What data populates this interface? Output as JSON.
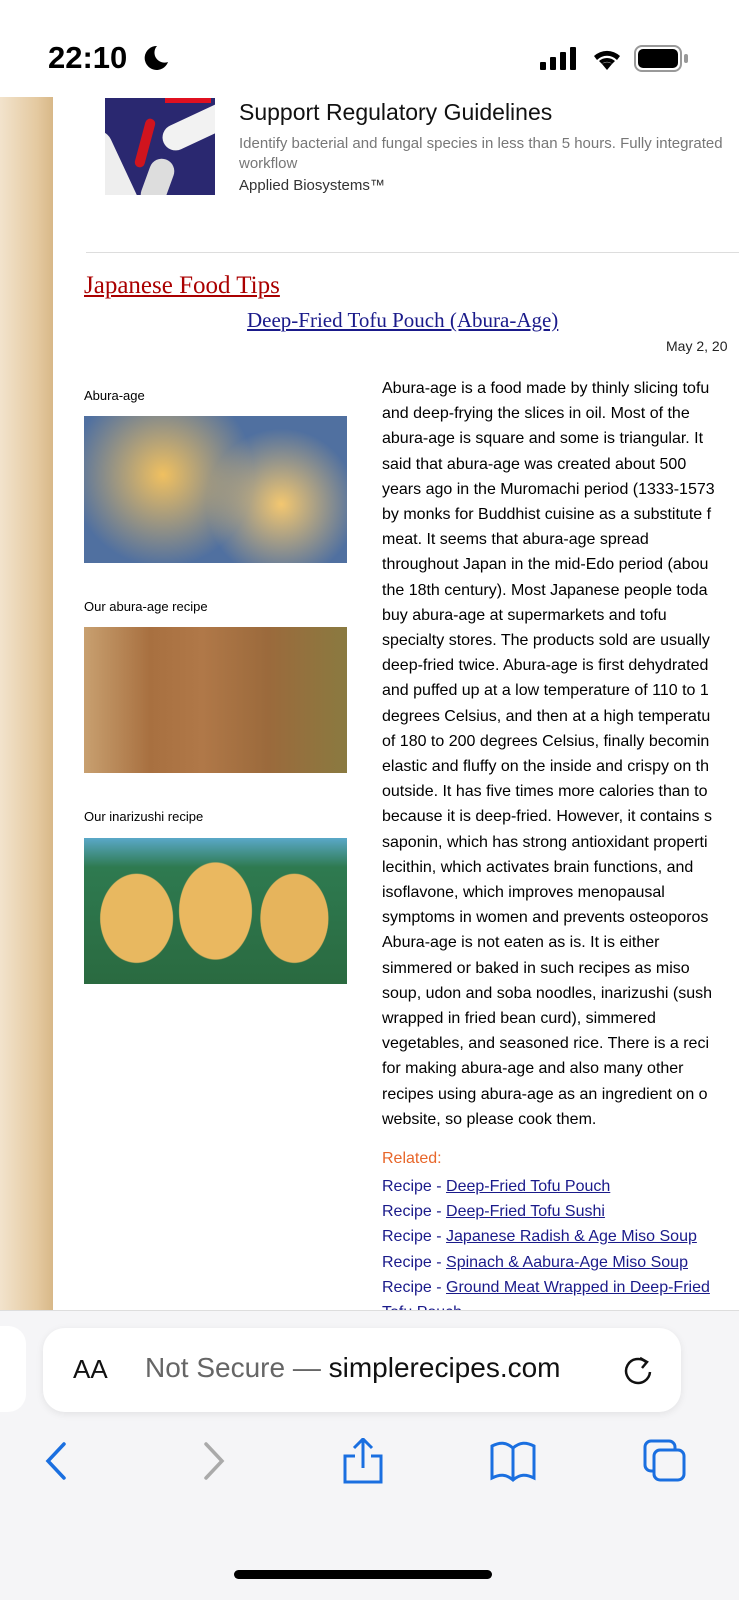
{
  "status_bar": {
    "time": "22:10"
  },
  "ad": {
    "title": "Support Regulatory Guidelines",
    "description": "Identify bacterial and fungal species in less than 5 hours. Fully integrated workflow",
    "brand": "Applied Biosystems™"
  },
  "page": {
    "site_title": "Japanese Food Tips",
    "article_title": "Deep-Fried Tofu Pouch (Abura-Age)",
    "date": "May 2, 20",
    "captions": [
      "Abura-age",
      "Our abura-age recipe",
      "Our inarizushi recipe"
    ],
    "body_lines": [
      "Abura-age is a food made by thinly slicing tofu",
      "and deep-frying the slices in oil. Most of the",
      "abura-age is square and some is triangular. It",
      "said that abura-age was created about 500",
      "years ago in the Muromachi period (1333-1573",
      "by monks for Buddhist cuisine as a substitute f",
      "meat. It seems that abura-age spread",
      "throughout Japan in the mid-Edo period (abou",
      "the 18th century). Most Japanese people toda",
      "buy abura-age at supermarkets and tofu",
      "specialty stores. The products sold are usually",
      "deep-fried twice. Abura-age is first dehydrated",
      "and puffed up at a low temperature of 110 to 1",
      "degrees Celsius, and then at a high temperatu",
      "of 180 to 200 degrees Celsius, finally becomin",
      "elastic and fluffy on the inside and crispy on th",
      "outside. It has five times more calories than to",
      "because it is deep-fried. However, it contains s",
      "saponin, which has strong antioxidant properti",
      "lecithin, which activates brain functions, and",
      "isoflavone, which improves menopausal",
      "symptoms in women and prevents osteoporos",
      "Abura-age is not eaten as is. It is either",
      "simmered or baked in such recipes as miso",
      "soup, udon and soba noodles, inarizushi (sush",
      "wrapped in fried bean curd), simmered",
      "vegetables, and seasoned rice. There is a reci",
      "for making abura-age and also many other",
      "recipes using abura-age as an ingredient on o",
      "website, so please cook them."
    ],
    "related_label": "Related:",
    "related": [
      {
        "prefix": "Recipe - ",
        "link": "Deep-Fried Tofu Pouch"
      },
      {
        "prefix": "Recipe - ",
        "link": "Deep-Fried Tofu Sushi"
      },
      {
        "prefix": "Recipe - ",
        "link": "Japanese Radish & Age Miso Soup"
      },
      {
        "prefix": "Recipe - ",
        "link": "Spinach & Aabura-Age Miso Soup"
      },
      {
        "prefix": "Recipe - ",
        "link": "Ground Meat Wrapped in Deep-Fried Tofu Pouch"
      }
    ]
  },
  "browser": {
    "aa": "AA",
    "not_secure": "Not Secure — ",
    "domain": "simplerecipes.com",
    "accent": "#1a6fe0"
  }
}
